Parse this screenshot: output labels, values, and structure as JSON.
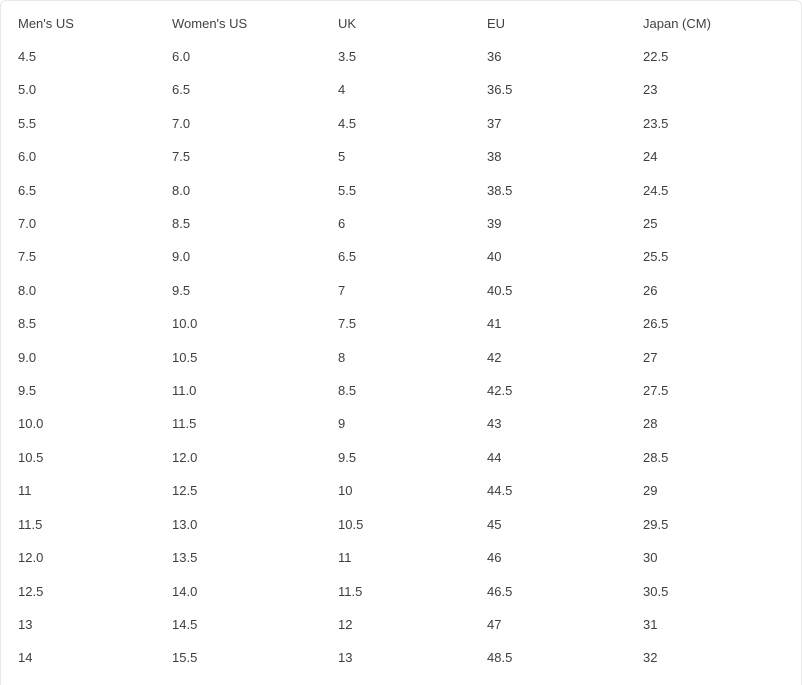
{
  "table": {
    "name": "shoe-size-conversion-chart",
    "columns": [
      {
        "key": "mens_us",
        "label": "Men's US"
      },
      {
        "key": "womens_us",
        "label": "Women's US"
      },
      {
        "key": "uk",
        "label": "UK"
      },
      {
        "key": "eu",
        "label": "EU"
      },
      {
        "key": "japan_cm",
        "label": "Japan (CM)"
      }
    ],
    "rows": [
      [
        "4.5",
        "6.0",
        "3.5",
        "36",
        "22.5"
      ],
      [
        "5.0",
        "6.5",
        "4",
        "36.5",
        "23"
      ],
      [
        "5.5",
        "7.0",
        "4.5",
        "37",
        "23.5"
      ],
      [
        "6.0",
        "7.5",
        "5",
        "38",
        "24"
      ],
      [
        "6.5",
        "8.0",
        "5.5",
        "38.5",
        "24.5"
      ],
      [
        "7.0",
        "8.5",
        "6",
        "39",
        "25"
      ],
      [
        "7.5",
        "9.0",
        "6.5",
        "40",
        "25.5"
      ],
      [
        "8.0",
        "9.5",
        "7",
        "40.5",
        "26"
      ],
      [
        "8.5",
        "10.0",
        "7.5",
        "41",
        "26.5"
      ],
      [
        "9.0",
        "10.5",
        "8",
        "42",
        "27"
      ],
      [
        "9.5",
        "11.0",
        "8.5",
        "42.5",
        "27.5"
      ],
      [
        "10.0",
        "11.5",
        "9",
        "43",
        "28"
      ],
      [
        "10.5",
        "12.0",
        "9.5",
        "44",
        "28.5"
      ],
      [
        "11",
        "12.5",
        "10",
        "44.5",
        "29"
      ],
      [
        "11.5",
        "13.0",
        "10.5",
        "45",
        "29.5"
      ],
      [
        "12.0",
        "13.5",
        "11",
        "46",
        "30"
      ],
      [
        "12.5",
        "14.0",
        "11.5",
        "46.5",
        "30.5"
      ],
      [
        "13",
        "14.5",
        "12",
        "47",
        "31"
      ],
      [
        "14",
        "15.5",
        "13",
        "48.5",
        "32"
      ]
    ]
  },
  "theme": {
    "background": "#ffffff",
    "border_color": "#e8e8e8",
    "header_text_color": "#3f4247",
    "cell_text_color": "#3c4043"
  }
}
